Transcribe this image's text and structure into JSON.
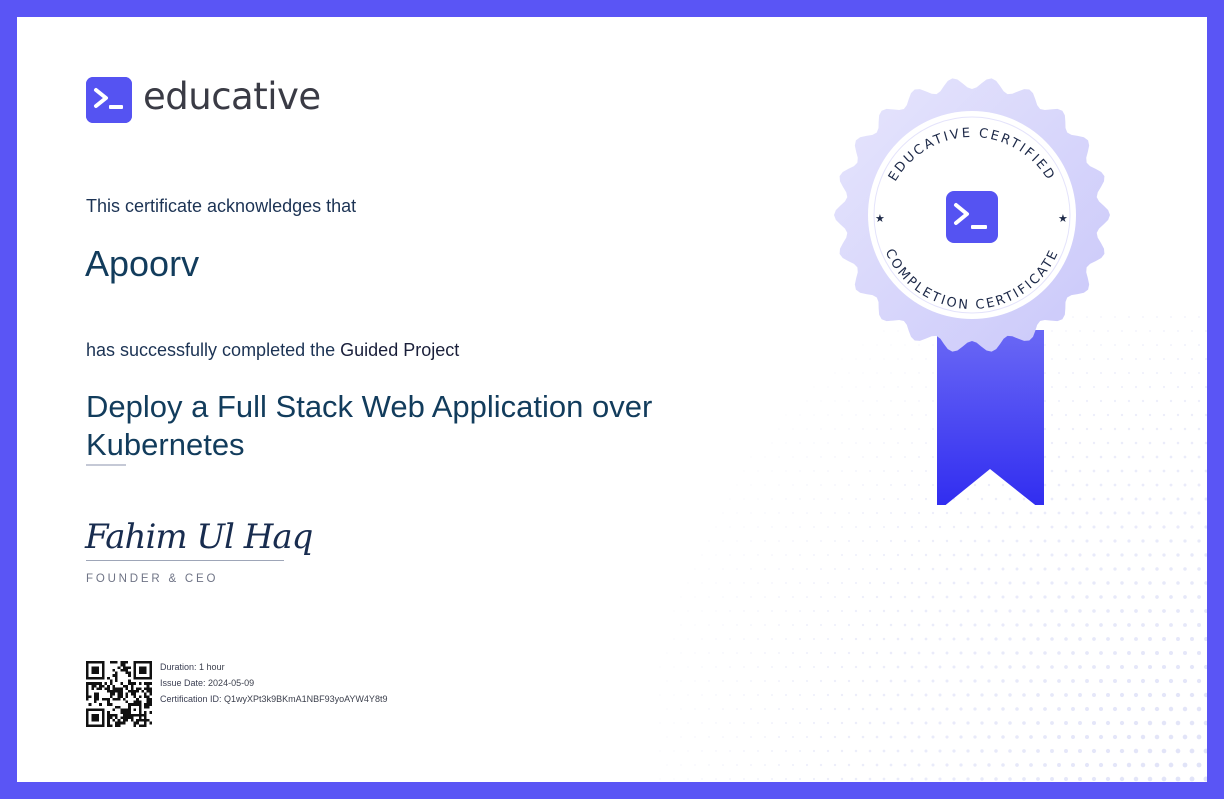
{
  "brand": {
    "name": "educative",
    "logo_icon": "terminal-prompt-icon",
    "accent": "#5553f2",
    "border_color": "#5a55f5"
  },
  "certificate": {
    "acknowledge_text": "This certificate acknowledges that",
    "recipient": "Apoorv",
    "completed_prefix": "has successfully completed the",
    "project_type": "Guided Project",
    "course_title": "Deploy a Full Stack Web Application over Kubernetes"
  },
  "signature": {
    "name": "Fahim Ul Haq",
    "title": "FOUNDER & CEO"
  },
  "details": {
    "duration_label": "Duration:",
    "duration_value": "1 hour",
    "issue_date_label": "Issue Date:",
    "issue_date_value": "2024-05-09",
    "cert_id_label": "Certification ID:",
    "cert_id_value": "Q1wyXPt3k9BKmA1NBF93yoAYW4Y8t9"
  },
  "seal": {
    "top_text": "EDUCATIVE CERTIFIED",
    "bottom_text": "COMPLETION CERTIFICATE",
    "icon": "terminal-prompt-icon",
    "ribbon_color": "#4a48f0"
  }
}
